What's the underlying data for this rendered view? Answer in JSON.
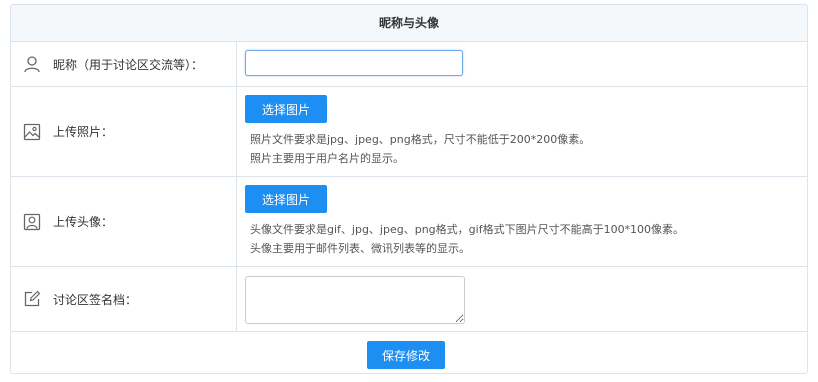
{
  "panel": {
    "title": "昵称与头像"
  },
  "nickname": {
    "label": "昵称（用于讨论区交流等）：",
    "icon": "user-icon",
    "value": "",
    "placeholder": ""
  },
  "photo": {
    "label": "上传照片：",
    "icon": "image-icon",
    "button_label": "选择图片",
    "hint_line1": "照片文件要求是jpg、jpeg、png格式，尺寸不能低于200*200像素。",
    "hint_line2": "照片主要用于用户名片的显示。"
  },
  "avatar": {
    "label": "上传头像：",
    "icon": "portrait-icon",
    "button_label": "选择图片",
    "hint_line1": "头像文件要求是gif、jpg、jpeg、png格式，gif格式下图片尺寸不能高于100*100像素。",
    "hint_line2": "头像主要用于邮件列表、微讯列表等的显示。"
  },
  "signature": {
    "label": "讨论区签名档：",
    "icon": "edit-icon",
    "value": ""
  },
  "footer": {
    "save_label": "保存修改"
  },
  "colors": {
    "accent": "#1e8ff2",
    "border": "#dde3ea",
    "header_bg": "#f5f8fb"
  }
}
